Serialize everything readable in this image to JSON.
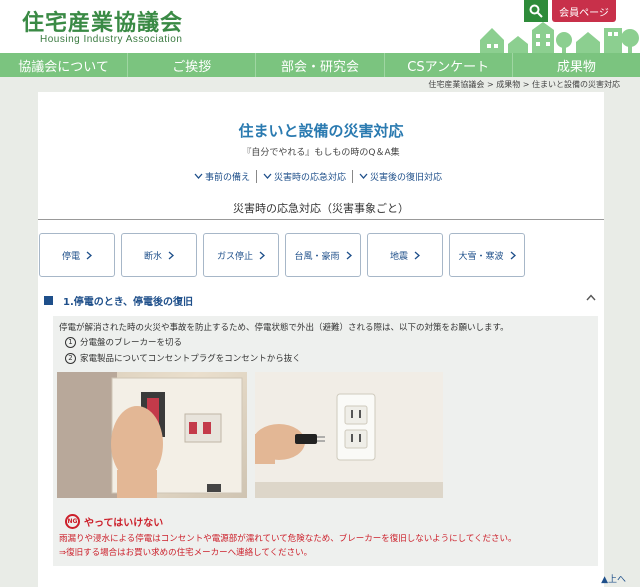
{
  "header": {
    "logo_jp": "住宅産業協議会",
    "logo_en": "Housing Industry Association",
    "member_label": "会員ページ"
  },
  "nav": {
    "items": [
      "協議会について",
      "ご挨拶",
      "部会・研究会",
      "CSアンケート",
      "成果物"
    ]
  },
  "breadcrumb": "住宅産業協議会 > 成果物 > 住まいと設備の災害対応",
  "main": {
    "title": "住まいと設備の災害対応",
    "subtitle": "『自分でやれる』もしもの時のQ＆A集",
    "anchors": [
      "事前の備え",
      "災害時の応急対応",
      "災害後の復旧対応"
    ],
    "section_title": "災害時の応急対応（災害事象ごと）",
    "categories": [
      "停電",
      "断水",
      "ガス停止",
      "台風・豪雨",
      "地震",
      "大雪・寒波"
    ]
  },
  "accordion": {
    "title": "1.停電のとき、停電後の復旧",
    "description": "停電が解消された時の火災や事故を防止するため、停電状態で外出（避難）される際は、以下の対策をお願いします。",
    "steps": [
      {
        "num": "1",
        "text": "分電盤のブレーカーを切る"
      },
      {
        "num": "2",
        "text": "家電製品についてコンセントプラグをコンセントから抜く"
      }
    ],
    "ng": {
      "badge": "NG",
      "title": "やってはいけない",
      "line1": "雨漏りや浸水による停電はコンセントや電源部が濡れていて危険なため、ブレーカーを復旧しないようにしてください。",
      "line2": "⇒復旧する場合はお買い求めの住宅メーカーへ連絡してください。"
    }
  },
  "to_top": "▲上へ",
  "colors": {
    "brand_green": "#3a8a45",
    "nav_green": "#7bc47f",
    "title_blue": "#2a7ab0",
    "link_blue": "#1e4f8a",
    "ng_red": "#cc1f2a",
    "member_red": "#c8304a"
  }
}
